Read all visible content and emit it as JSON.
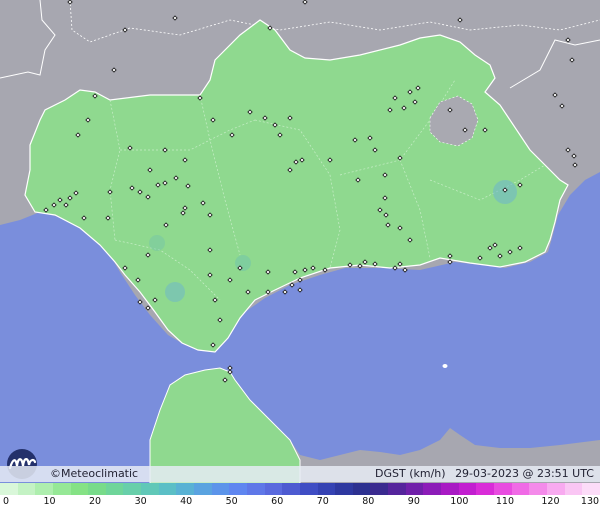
{
  "map": {
    "brand": "©Meteoclimatic",
    "variable": "DGST (km/h)",
    "date": "29-03-2023 @ 23:51 UTC",
    "colors": {
      "sea": "#7a8edc",
      "land_gray": "#a9a9b1",
      "region_green": "#8fd98f",
      "border_white": "#ffffff"
    }
  },
  "scale": {
    "labels": [
      "0",
      "10",
      "20",
      "30",
      "40",
      "50",
      "60",
      "70",
      "80",
      "90",
      "100",
      "110",
      "120",
      "130"
    ],
    "colors": [
      "#d9f7d9",
      "#c4f2c4",
      "#aeeeae",
      "#96e896",
      "#85e285",
      "#78db8a",
      "#6fd59a",
      "#68cfaa",
      "#60c8b8",
      "#5bbfc6",
      "#59b2d4",
      "#5aa3e0",
      "#5c94ea",
      "#5f86f0",
      "#5f78e8",
      "#5a6ade",
      "#4d5bd1",
      "#3f4dc4",
      "#3542b3",
      "#2e38a0",
      "#2c3090",
      "#3a2a8f",
      "#55249c",
      "#7020aa",
      "#8c1cb8",
      "#a81ac4",
      "#c21ed0",
      "#d92cd8",
      "#e84ce0",
      "#f06ae6",
      "#f48aea",
      "#f8aaf0",
      "#fac6f4",
      "#fcdcf8"
    ]
  }
}
